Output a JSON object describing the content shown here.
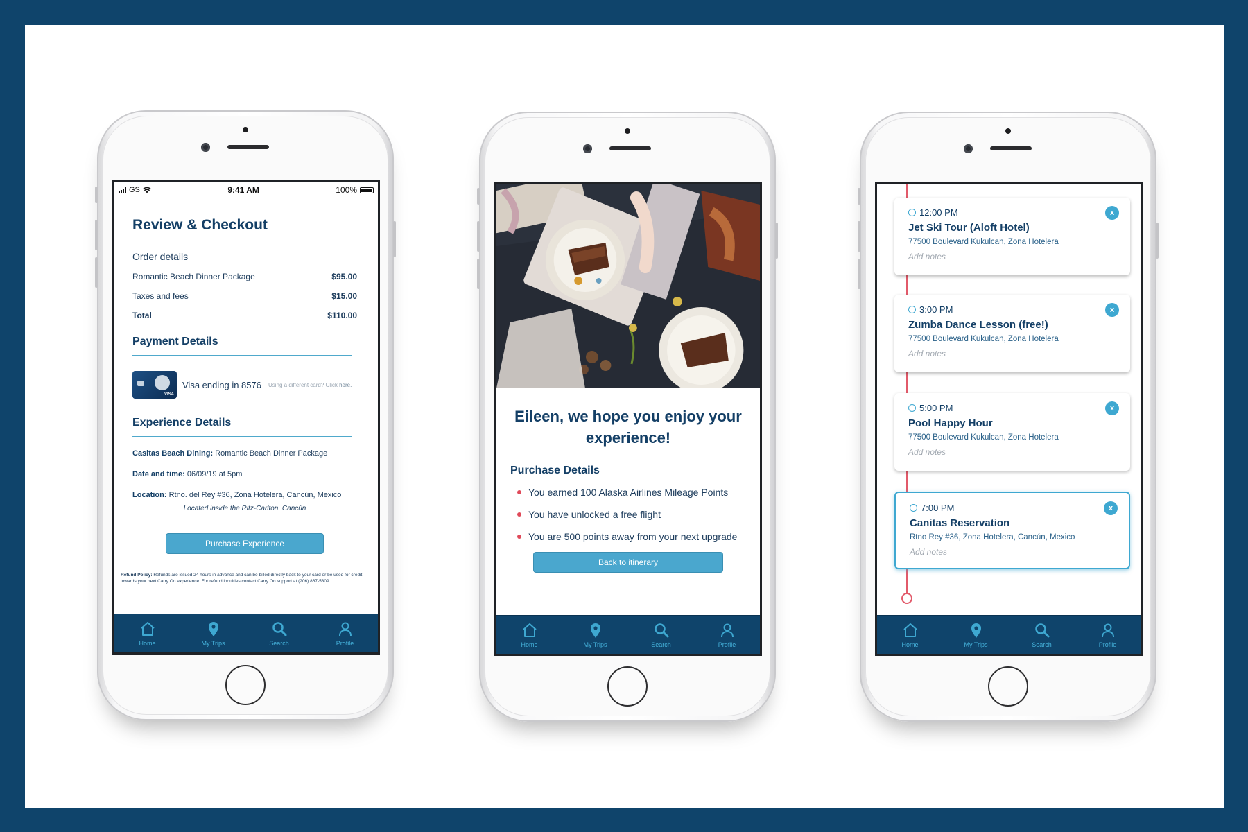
{
  "colors": {
    "navy": "#0f446b",
    "accent": "#4aa7ce",
    "bullet": "#e04a5a",
    "timeline": "#e25a6a"
  },
  "tabbar": {
    "items": [
      {
        "label": "Home",
        "icon": "home-icon"
      },
      {
        "label": "My Trips",
        "icon": "map-pin-icon"
      },
      {
        "label": "Search",
        "icon": "search-icon"
      },
      {
        "label": "Profile",
        "icon": "user-icon"
      }
    ]
  },
  "checkout": {
    "status": {
      "carrier": "GS",
      "time": "9:41 AM",
      "battery": "100%"
    },
    "title": "Review & Checkout",
    "order_label": "Order details",
    "lines": [
      {
        "label": "Romantic Beach Dinner Package",
        "value": "$95.00"
      },
      {
        "label": "Taxes and fees",
        "value": "$15.00"
      },
      {
        "label": "Total",
        "value": "$110.00"
      }
    ],
    "payment_title": "Payment Details",
    "card_text": "Visa ending in 8576",
    "card_hint": "Using a different card? Click ",
    "card_hint_link": "here.",
    "experience_title": "Experience Details",
    "dining_label": "Casitas Beach Dining:",
    "dining_value": "Romantic Beach Dinner Package",
    "date_label": "Date and time:",
    "date_value": "06/09/19 at 5pm",
    "location_label": "Location:",
    "location_value": "Rtno. del Rey #36, Zona Hotelera, Cancún, Mexico",
    "location_note": "Located inside the Ritz-Carlton. Cancún",
    "purchase_button": "Purchase Experience",
    "policy_label": "Refund Policy:",
    "policy_text": "Refunds are issued 24 hours in advance and can be billed directly back to your card or be used for credit towards your next Carry On experience. For refund inquiries contact Carry On support at (206) 867-5309"
  },
  "confirm": {
    "headline": "Eileen, we hope you enjoy your experience!",
    "details_title": "Purchase Details",
    "bullets": [
      "You earned 100 Alaska Airlines Mileage Points",
      "You have unlocked a free flight",
      "You are 500 points away from your next upgrade"
    ],
    "back_button": "Back to itinerary"
  },
  "itinerary": {
    "events": [
      {
        "time": "12:00 PM",
        "title": "Jet Ski Tour (Aloft Hotel)",
        "address": "77500 Boulevard Kukulcan, Zona Hotelera",
        "notes": "Add notes",
        "close": "x"
      },
      {
        "time": "3:00 PM",
        "title": "Zumba Dance Lesson (free!)",
        "address": "77500 Boulevard Kukulcan, Zona Hotelera",
        "notes": "Add notes",
        "close": "x"
      },
      {
        "time": "5:00 PM",
        "title": "Pool Happy Hour",
        "address": "77500 Boulevard Kukulcan, Zona Hotelera",
        "notes": "Add notes",
        "close": "x"
      },
      {
        "time": "7:00 PM",
        "title": "Canitas Reservation",
        "address": "Rtno Rey #36, Zona Hotelera, Cancún, Mexico",
        "notes": "Add notes",
        "close": "x"
      }
    ]
  }
}
